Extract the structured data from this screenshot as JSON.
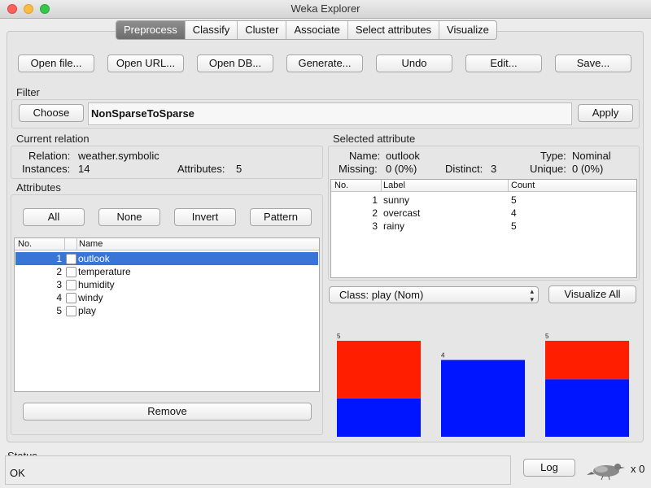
{
  "window": {
    "title": "Weka Explorer"
  },
  "tabs": [
    "Preprocess",
    "Classify",
    "Cluster",
    "Associate",
    "Select attributes",
    "Visualize"
  ],
  "toolbar": {
    "open_file": "Open file...",
    "open_url": "Open URL...",
    "open_db": "Open DB...",
    "generate": "Generate...",
    "undo": "Undo",
    "edit": "Edit...",
    "save": "Save..."
  },
  "filter": {
    "label": "Filter",
    "choose": "Choose",
    "value": "NonSparseToSparse",
    "apply": "Apply"
  },
  "relation": {
    "label": "Current relation",
    "relation_label": "Relation:",
    "relation_value": "weather.symbolic",
    "instances_label": "Instances:",
    "instances_value": "14",
    "attributes_label": "Attributes:",
    "attributes_value": "5"
  },
  "attributes": {
    "label": "Attributes",
    "buttons": {
      "all": "All",
      "none": "None",
      "invert": "Invert",
      "pattern": "Pattern"
    },
    "col_no": "No.",
    "col_name": "Name",
    "rows": [
      {
        "no": "1",
        "name": "outlook",
        "selected": true
      },
      {
        "no": "2",
        "name": "temperature",
        "selected": false
      },
      {
        "no": "3",
        "name": "humidity",
        "selected": false
      },
      {
        "no": "4",
        "name": "windy",
        "selected": false
      },
      {
        "no": "5",
        "name": "play",
        "selected": false
      }
    ],
    "remove": "Remove"
  },
  "selected_attribute": {
    "label": "Selected attribute",
    "name_label": "Name:",
    "name_value": "outlook",
    "type_label": "Type:",
    "type_value": "Nominal",
    "missing_label": "Missing:",
    "missing_value": "0 (0%)",
    "distinct_label": "Distinct:",
    "distinct_value": "3",
    "unique_label": "Unique:",
    "unique_value": "0 (0%)",
    "col_no": "No.",
    "col_label": "Label",
    "col_count": "Count",
    "rows": [
      {
        "no": "1",
        "label": "sunny",
        "count": "5"
      },
      {
        "no": "2",
        "label": "overcast",
        "count": "4"
      },
      {
        "no": "3",
        "label": "rainy",
        "count": "5"
      }
    ]
  },
  "class_select": {
    "value": "Class: play (Nom)"
  },
  "visualize_all": "Visualize All",
  "chart_data": {
    "type": "bar",
    "categories": [
      "sunny",
      "overcast",
      "rainy"
    ],
    "totals": [
      "5",
      "4",
      "5"
    ],
    "series": [
      {
        "color": "#0015ff",
        "values": [
          2,
          4,
          3
        ]
      },
      {
        "color": "#ff1e00",
        "values": [
          3,
          0,
          2
        ]
      }
    ],
    "ylim": [
      0,
      5
    ]
  },
  "status": {
    "label": "Status",
    "text": "OK",
    "log": "Log",
    "count": "x 0"
  }
}
